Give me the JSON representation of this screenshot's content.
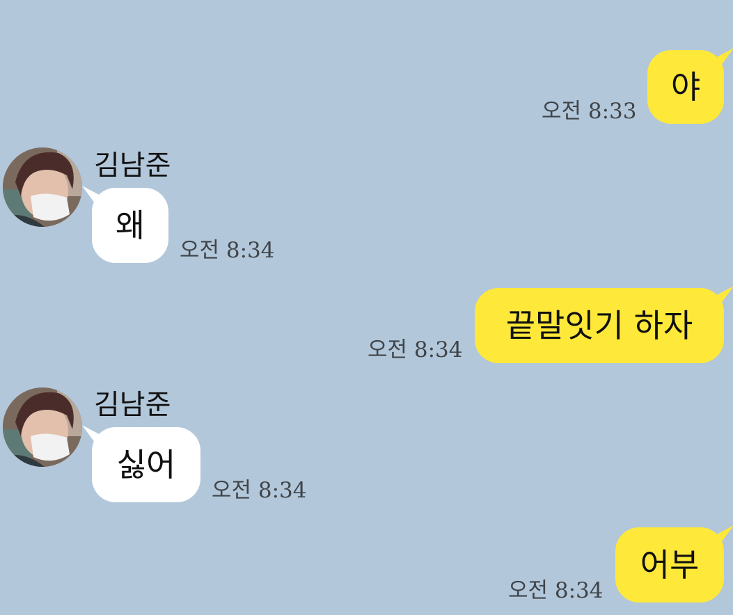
{
  "chat": {
    "messages": [
      {
        "direction": "out",
        "text": "야",
        "time": "오전 8:33"
      },
      {
        "direction": "in",
        "sender": "김남준",
        "avatar": "avatar-photo",
        "text": "왜",
        "time": "오전 8:34"
      },
      {
        "direction": "out",
        "text": "끝말잇기 하자",
        "time": "오전 8:34"
      },
      {
        "direction": "in",
        "sender": "김남준",
        "avatar": "avatar-photo",
        "text": "싫어",
        "time": "오전 8:34"
      },
      {
        "direction": "out",
        "text": "어부",
        "time": "오전 8:34"
      }
    ]
  },
  "colors": {
    "background": "#b2c7da",
    "outgoing_bubble": "#fee83a",
    "incoming_bubble": "#ffffff"
  }
}
